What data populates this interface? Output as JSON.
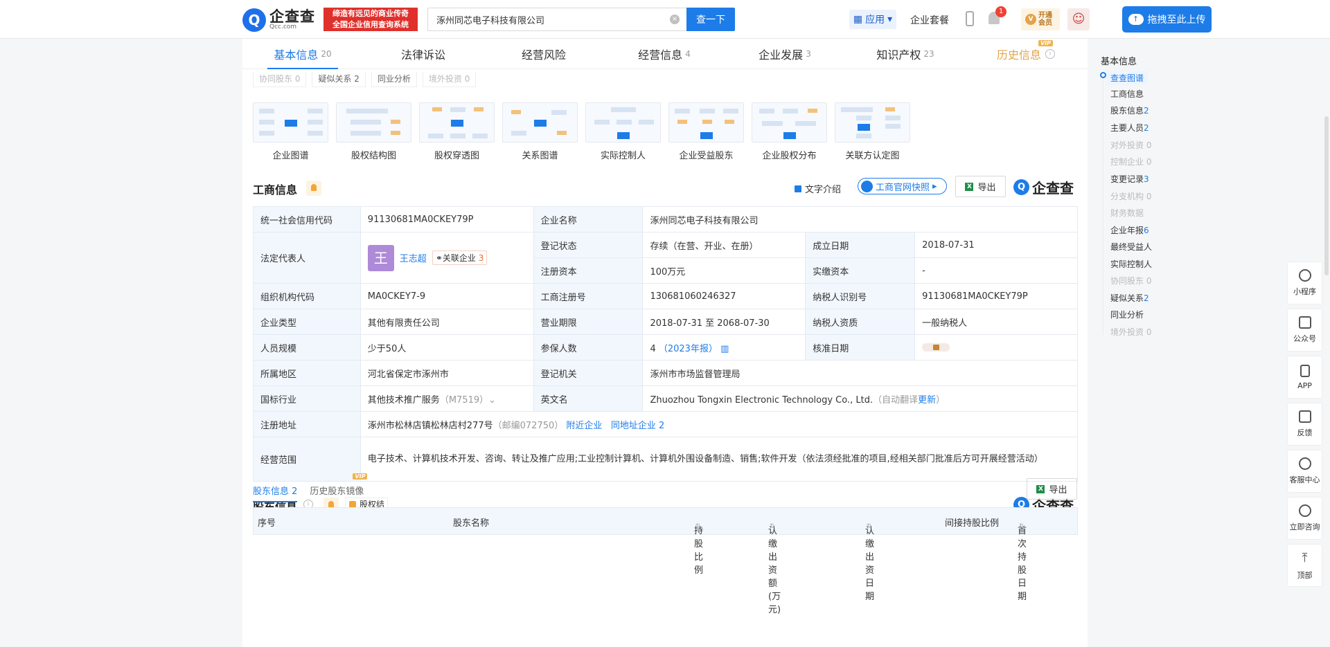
{
  "header": {
    "logo_mark": "Q",
    "logo_name": "企查查",
    "logo_domain": "Qcc.com",
    "slogan_line1": "缔造有远见的商业传奇",
    "slogan_line2": "全国企业信用查询系统",
    "search_value": "涿州同芯电子科技有限公司",
    "search_button": "查一下",
    "app_label": "应用",
    "nav_package": "企业套餐",
    "notif_count": "1",
    "vip_line1": "开通",
    "vip_line2": "会员",
    "upload_label": "拖拽至此上传"
  },
  "tabs": [
    {
      "label": "基本信息",
      "count": "20"
    },
    {
      "label": "法律诉讼",
      "count": ""
    },
    {
      "label": "经营风险",
      "count": ""
    },
    {
      "label": "经营信息",
      "count": "4"
    },
    {
      "label": "企业发展",
      "count": "3"
    },
    {
      "label": "知识产权",
      "count": "23"
    },
    {
      "label": "历史信息",
      "count": "",
      "badge": "VIP"
    }
  ],
  "subtags": [
    "协同股东 0",
    "疑似关系 2",
    "同业分析",
    "境外投资 0"
  ],
  "diagrams": [
    "企业图谱",
    "股权结构图",
    "股权穿透图",
    "关系图谱",
    "实际控制人",
    "企业受益股东",
    "企业股权分布",
    "关联方认定图"
  ],
  "business": {
    "title": "工商信息",
    "text_intro": "文字介绍",
    "gov_snapshot": "工商官网快照",
    "export": "导出",
    "brand": "企查查",
    "rows": {
      "credit_code_k": "统一社会信用代码",
      "credit_code_v": "91130681MA0CKEY79P",
      "company_name_k": "企业名称",
      "company_name_v": "涿州同芯电子科技有限公司",
      "legal_rep_k": "法定代表人",
      "legal_rep_avatar": "王",
      "legal_rep_v": "王志超",
      "legal_rep_tag": "关联企业",
      "legal_rep_tag_count": "3",
      "reg_status_k": "登记状态",
      "reg_status_v": "存续（在营、开业、在册）",
      "found_date_k": "成立日期",
      "found_date_v": "2018-07-31",
      "reg_capital_k": "注册资本",
      "reg_capital_v": "100万元",
      "paid_capital_k": "实缴资本",
      "paid_capital_v": "-",
      "org_code_k": "组织机构代码",
      "org_code_v": "MA0CKEY7-9",
      "reg_no_k": "工商注册号",
      "reg_no_v": "130681060246327",
      "taxpayer_id_k": "纳税人识别号",
      "taxpayer_id_v": "91130681MA0CKEY79P",
      "type_k": "企业类型",
      "type_v": "其他有限责任公司",
      "term_k": "营业期限",
      "term_v": "2018-07-31 至 2068-07-30",
      "taxpayer_q_k": "纳税人资质",
      "taxpayer_q_v": "一般纳税人",
      "staff_k": "人员规模",
      "staff_v": "少于50人",
      "insured_k": "参保人数",
      "insured_v": "4",
      "insured_year": "（2023年报）",
      "approve_k": "核准日期",
      "region_k": "所属地区",
      "region_v": "河北省保定市涿州市",
      "authority_k": "登记机关",
      "authority_v": "涿州市市场监督管理局",
      "industry_k": "国标行业",
      "industry_v": "其他技术推广服务",
      "industry_code": "（M7519）",
      "english_k": "英文名",
      "english_v": "Zhuozhou Tongxin Electronic Technology Co., Ltd.",
      "english_note": "（自动翻译",
      "english_update": "更新",
      "english_close": "）",
      "address_k": "注册地址",
      "address_v": "涿州市松林店镇松林店村277号",
      "address_zip": "（邮编072750）",
      "address_nearby": "附近企业",
      "address_same": "同地址企业 2",
      "scope_k": "经营范围",
      "scope_v": "电子技术、计算机技术开发、咨询、转让及推广应用;工业控制计算机、计算机外围设备制造、销售;软件开发（依法须经批准的项目,经相关部门批准后方可开展经营活动）"
    }
  },
  "shareholders": {
    "title": "股东信息",
    "equity_tag": "股权结构",
    "tab_current": "股东信息 2",
    "tab_history": "历史股东镜像",
    "tab_history_badge": "VIP",
    "export": "导出",
    "brand": "企查查",
    "columns": [
      "序号",
      "股东名称",
      "持股比例",
      "认缴出资额(万元)",
      "认缴出资日期",
      "间接持股比例",
      "首次持股日期"
    ]
  },
  "side_nav": {
    "header": "基本信息",
    "items": [
      {
        "label": "查查图谱",
        "count": "",
        "state": "active"
      },
      {
        "label": "工商信息",
        "count": "",
        "state": "normal"
      },
      {
        "label": "股东信息",
        "count": "2",
        "state": "normal"
      },
      {
        "label": "主要人员",
        "count": "2",
        "state": "normal"
      },
      {
        "label": "对外投资",
        "count": "0",
        "state": "dim"
      },
      {
        "label": "控制企业",
        "count": "0",
        "state": "dim"
      },
      {
        "label": "变更记录",
        "count": "3",
        "state": "normal"
      },
      {
        "label": "分支机构",
        "count": "0",
        "state": "dim"
      },
      {
        "label": "财务数据",
        "count": "",
        "state": "dim"
      },
      {
        "label": "企业年报",
        "count": "6",
        "state": "normal"
      },
      {
        "label": "最终受益人",
        "count": "",
        "state": "normal"
      },
      {
        "label": "实际控制人",
        "count": "",
        "state": "normal"
      },
      {
        "label": "协同股东",
        "count": "0",
        "state": "dim"
      },
      {
        "label": "疑似关系",
        "count": "2",
        "state": "normal"
      },
      {
        "label": "同业分析",
        "count": "",
        "state": "normal"
      },
      {
        "label": "境外投资",
        "count": "0",
        "state": "dim"
      }
    ]
  },
  "right_dock": [
    "小程序",
    "公众号",
    "APP",
    "反馈",
    "客服中心",
    "立即咨询",
    "顶部"
  ]
}
